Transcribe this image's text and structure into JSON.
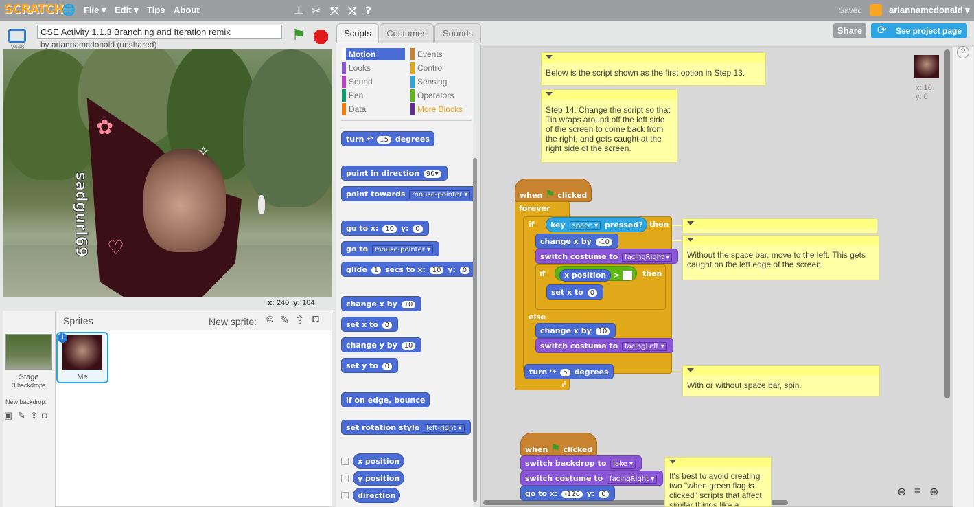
{
  "app": {
    "logo": "SCRATCH"
  },
  "menu": {
    "file": "File ▾",
    "edit": "Edit ▾",
    "tips": "Tips",
    "about": "About"
  },
  "account": {
    "saved": "Saved",
    "username": "ariannamcdonald ▾"
  },
  "project": {
    "title": "CSE Activity 1.1.3 Branching and Iteration remix",
    "byline": "by ariannamcdonald (unshared)",
    "version": "v448"
  },
  "header_buttons": {
    "share": "Share",
    "see_project": "See project page"
  },
  "stage": {
    "coord_x_label": "x:",
    "coord_x": "240",
    "coord_y_label": "y:",
    "coord_y": "104",
    "sprite_text": "sadgurl69"
  },
  "sprites_pane": {
    "title": "Sprites",
    "new_sprite": "New sprite:",
    "stage_label": "Stage",
    "backdrops": "3 backdrops",
    "new_backdrop": "New backdrop:",
    "sprite_name": "Me"
  },
  "tabs": {
    "scripts": "Scripts",
    "costumes": "Costumes",
    "sounds": "Sounds"
  },
  "categories": [
    {
      "label": "Motion",
      "color": "#4a6cd4"
    },
    {
      "label": "Events",
      "color": "#c88330"
    },
    {
      "label": "Looks",
      "color": "#8a55d7"
    },
    {
      "label": "Control",
      "color": "#e1a91a"
    },
    {
      "label": "Sound",
      "color": "#bb42c3"
    },
    {
      "label": "Sensing",
      "color": "#2ca5e2"
    },
    {
      "label": "Pen",
      "color": "#0e9a6c"
    },
    {
      "label": "Operators",
      "color": "#5cb712"
    },
    {
      "label": "Data",
      "color": "#ee7d16"
    },
    {
      "label": "More Blocks",
      "color": "#632d99"
    }
  ],
  "palette": {
    "turn": "turn",
    "turn_deg": "15",
    "degrees": "degrees",
    "point_dir": "point in direction",
    "dir_val": "90▾",
    "point_towards": "point towards",
    "mouse_pointer": "mouse-pointer ▾",
    "goto_xy": "go to x:",
    "x0": "0",
    "y_label": "y:",
    "y0": "0",
    "goto": "go to",
    "glide": "glide",
    "glide_secs": "1",
    "secs_to_x": "secs to x:",
    "change_x": "change x by",
    "ten": "10",
    "set_x": "set x to",
    "change_y": "change y by",
    "set_y": "set y to",
    "bounce": "if on edge, bounce",
    "rot_style": "set rotation style",
    "lr": "left-right ▾",
    "x_pos": "x position",
    "y_pos": "y position",
    "direction": "direction"
  },
  "script1": {
    "when": "when",
    "clicked": "clicked",
    "forever": "forever",
    "if": "if",
    "key": "key",
    "space": "space ▾",
    "pressed": "pressed?",
    "then": "then",
    "change_x": "change x by",
    "neg10": "-10",
    "switch_costume": "switch costume to",
    "facing_right": "facingRight ▾",
    "facing_left": "facingLeft ▾",
    "x_position": "x position",
    "gt": ">",
    "set_x": "set x to",
    "zero": "0",
    "else": "else",
    "ten": "10",
    "turn": "turn",
    "five": "5",
    "degrees": "degrees"
  },
  "script2": {
    "when": "when",
    "clicked": "clicked",
    "switch_backdrop": "switch backdrop to",
    "lake": "lake ▾",
    "switch_costume": "switch costume to",
    "facing_right": "facingRight ▾",
    "goto_x": "go to x:",
    "x_val": "-126",
    "y_label": "y:",
    "y_val": "0"
  },
  "notes": {
    "n1": "Below is the script shown as the first option in Step 13.",
    "n2": "Step 14. Change the script so that Tia wraps around off the left side of the screen to come back from the right, and gets caught at the right side of the screen.",
    "n4": "Without the space bar, move to the left. This gets caught on the left edge of the screen.",
    "n5": "With or without space bar, spin.",
    "n6": "It's best to avoid creating two \"when green flag is clicked\" scripts that affect similar things like a"
  },
  "sprite_info": {
    "x": "x: 10",
    "y": "y: 0"
  }
}
